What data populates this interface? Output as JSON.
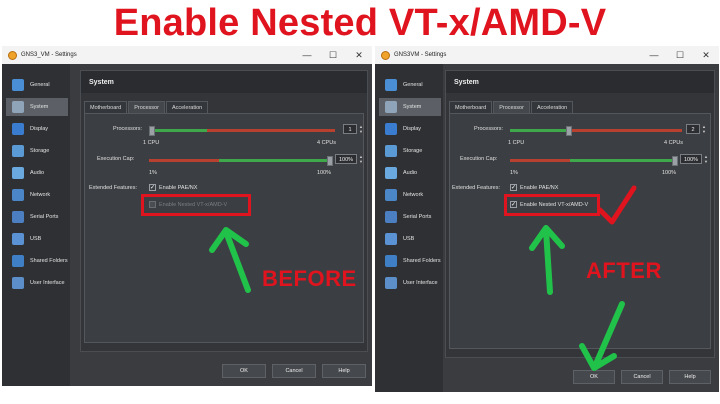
{
  "banner": {
    "title": "Enable Nested VT-x/AMD-V"
  },
  "left_window": {
    "title": "GNS3_VM - Settings",
    "sidebar": [
      "General",
      "System",
      "Display",
      "Storage",
      "Audio",
      "Network",
      "Serial Ports",
      "USB",
      "Shared Folders",
      "User Interface"
    ],
    "section": "System",
    "tabs": [
      "Motherboard",
      "Processor",
      "Acceleration"
    ],
    "processors_label": "Processors:",
    "processors_value": "1",
    "processors_min": "1 CPU",
    "processors_max": "4 CPUs",
    "cap_label": "Execution Cap:",
    "cap_value": "100%",
    "cap_min": "1%",
    "cap_max": "100%",
    "features_label": "Extended Features:",
    "pae_label": "Enable PAE/NX",
    "nested_label": "Enable Nested VT-x/AMD-V",
    "nested_checked": false,
    "buttons": {
      "ok": "OK",
      "cancel": "Cancel",
      "help": "Help"
    }
  },
  "right_window": {
    "title": "GNS3VM - Settings",
    "sidebar": [
      "General",
      "System",
      "Display",
      "Storage",
      "Audio",
      "Network",
      "Serial Ports",
      "USB",
      "Shared Folders",
      "User Interface"
    ],
    "section": "System",
    "tabs": [
      "Motherboard",
      "Processor",
      "Acceleration"
    ],
    "processors_label": "Processors:",
    "processors_value": "2",
    "processors_min": "1 CPU",
    "processors_max": "4 CPUs",
    "cap_label": "Execution Cap:",
    "cap_value": "100%",
    "cap_min": "1%",
    "cap_max": "100%",
    "features_label": "Extended Features:",
    "pae_label": "Enable PAE/NX",
    "nested_label": "Enable Nested VT-x/AMD-V",
    "nested_checked": true,
    "buttons": {
      "ok": "OK",
      "cancel": "Cancel",
      "help": "Help"
    }
  },
  "annotations": {
    "before": "BEFORE",
    "after": "AFTER"
  },
  "colors": {
    "accent_red": "#e0141e",
    "arrow_green": "#21c24a",
    "slider_green": "#3fa84a",
    "slider_red": "#b8402f"
  },
  "window_controls": {
    "minimize": "—",
    "maximize": "☐",
    "close": "✕"
  }
}
